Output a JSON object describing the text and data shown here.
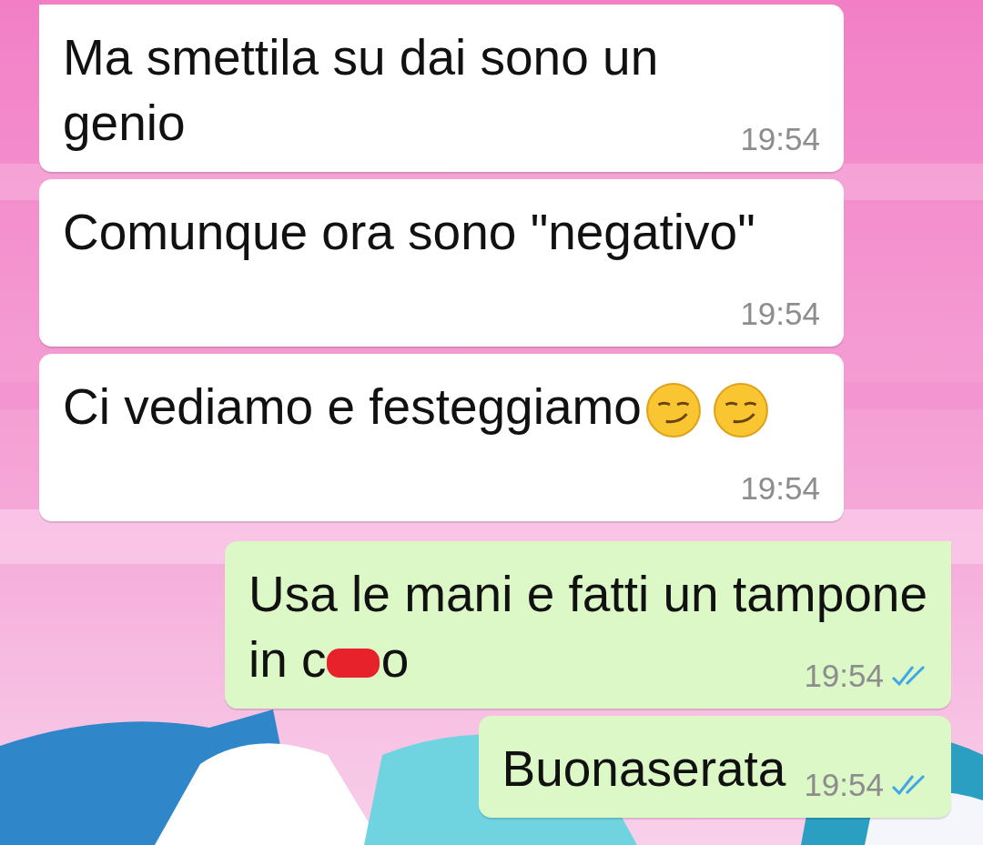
{
  "messages": [
    {
      "kind": "incoming",
      "tail": true,
      "text": "Ma smettila su dai sono un genio",
      "time": "19:54"
    },
    {
      "kind": "incoming",
      "tail": false,
      "text": "Comunque ora sono \"negativo\"",
      "time": "19:54"
    },
    {
      "kind": "incoming",
      "tail": false,
      "text": "Ci vediamo e festeggiamo",
      "emojis": [
        {
          "kind": "smirk"
        },
        {
          "kind": "smirk"
        }
      ],
      "time": "19:54"
    },
    {
      "kind": "outgoing",
      "tail": true,
      "text": "Usa le mani e fatti un tampone",
      "redacted": true,
      "before_redaction": "in c",
      "after_redaction": "o",
      "time": "19:54",
      "read": true
    },
    {
      "kind": "outgoing",
      "tail": false,
      "text": "Buonaserata",
      "time": "19:54",
      "read": true
    }
  ]
}
